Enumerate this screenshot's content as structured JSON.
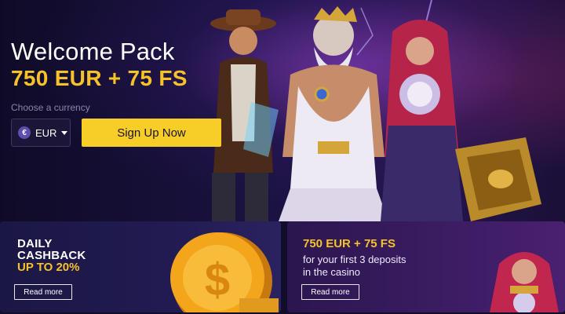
{
  "hero": {
    "title": "Welcome Pack",
    "offer": "750 EUR + 75 FS",
    "currency_label": "Choose a currency",
    "currency_value": "EUR",
    "currency_symbol": "€",
    "signup_label": "Sign Up Now"
  },
  "cards": {
    "cashback": {
      "line1": "DAILY",
      "line2": "CASHBACK",
      "line3": "UP TO 20%",
      "read_more": "Read more"
    },
    "deposit": {
      "title": "750 EUR + 75 FS",
      "line1": "for your first 3 deposits",
      "line2": "in the casino",
      "read_more": "Read more"
    }
  },
  "colors": {
    "accent_yellow": "#f7cd27",
    "background": "#120d2a"
  }
}
